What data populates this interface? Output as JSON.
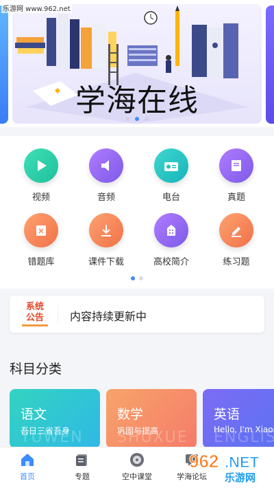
{
  "watermark": "乐游网 www.962.net",
  "banner": {
    "title": "学海在线"
  },
  "grid": {
    "items": [
      {
        "label": "视频",
        "icon": "play-icon",
        "color": "#2fd1a8"
      },
      {
        "label": "音频",
        "icon": "speaker-icon",
        "color": "#9a6cf2"
      },
      {
        "label": "电台",
        "icon": "radio-icon",
        "color": "#22c2c0"
      },
      {
        "label": "真题",
        "icon": "book-icon",
        "color": "#9a6cf2"
      },
      {
        "label": "错题库",
        "icon": "notebook-icon",
        "color": "#f58b5b"
      },
      {
        "label": "课件下载",
        "icon": "download-icon",
        "color": "#f58b5b"
      },
      {
        "label": "高校简介",
        "icon": "building-icon",
        "color": "#9a6cf2"
      },
      {
        "label": "练习题",
        "icon": "pencil-icon",
        "color": "#f58b5b"
      }
    ]
  },
  "notice": {
    "logo_line1": "系统",
    "logo_line2": "公告",
    "text": "内容持续更新中"
  },
  "subjects": {
    "title": "科目分类",
    "items": [
      {
        "name": "语文",
        "sub": "吾日三省吾身",
        "bg": "YUWEN",
        "color1": "#33d3c0",
        "color2": "#2fb9e6"
      },
      {
        "name": "数学",
        "sub": "巩固与提高",
        "bg": "SHUXUE",
        "color1": "#f7a46a",
        "color2": "#f57b6a"
      },
      {
        "name": "英语",
        "sub": "Hello, I'm Xiaoming",
        "bg": "ENGLISH",
        "color1": "#7c6cf4",
        "color2": "#5a72f2"
      }
    ]
  },
  "nav": {
    "items": [
      {
        "label": "首页",
        "icon": "home-icon"
      },
      {
        "label": "专题",
        "icon": "topic-icon"
      },
      {
        "label": "空中课堂",
        "icon": "disc-icon"
      },
      {
        "label": "学海论坛",
        "icon": "forum-icon"
      }
    ]
  },
  "brand": {
    "text1": "962",
    "text2": ".NET",
    "text3": "乐游网"
  }
}
